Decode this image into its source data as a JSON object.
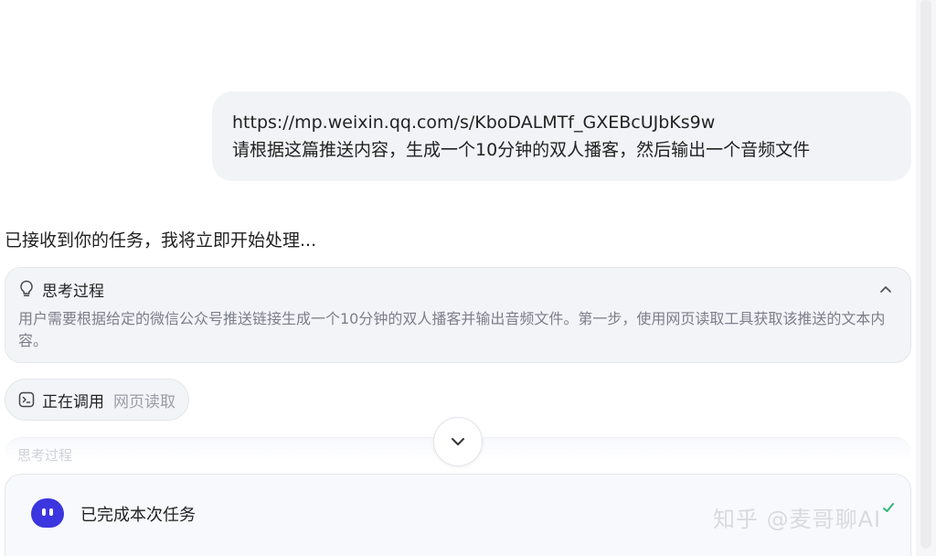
{
  "user_message": {
    "url": "https://mp.weixin.qq.com/s/KboDALMTf_GXEBcUJbKs9w",
    "request": "请根据这篇推送内容，生成一个10分钟的双人播客，然后输出一个音频文件"
  },
  "assistant": {
    "intro": "已接收到你的任务，我将立即开始处理..."
  },
  "thinking": {
    "label": "思考过程",
    "body": "用户需要根据给定的微信公众号推送链接生成一个10分钟的双人播客并输出音频文件。第一步，使用网页读取工具获取该推送的文本内容。",
    "icon": "lightbulb-icon",
    "toggle_icon": "chevron-up-icon"
  },
  "tool_call": {
    "status": "正在调用",
    "tool": "网页读取",
    "icon": "terminal-icon"
  },
  "faded_next": {
    "label": "思考过程"
  },
  "completion": {
    "text": "已完成本次任务",
    "avatar_color": "#3b36e0",
    "check_color": "#2bb673"
  },
  "watermark": {
    "text": "知乎 @麦哥聊AI"
  }
}
